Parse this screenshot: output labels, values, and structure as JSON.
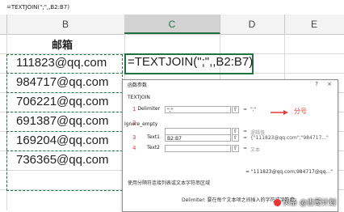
{
  "formula_bar": {
    "text": "=TEXTJOIN(\";\",,B2:B7)"
  },
  "columns": [
    "B",
    "C",
    "D",
    "E"
  ],
  "sheet": {
    "header": "邮箱",
    "emails": [
      "111823@qq.com",
      "984717@qq.com",
      "706221@qq.com",
      "691387@qq.com",
      "169204@qq.com",
      "736365@qq.com"
    ],
    "formula_cell": "=TEXTJOIN(\";\",,B2:B7)"
  },
  "dialog": {
    "title": "函数参数",
    "help": "?",
    "close": "×",
    "function_name": "TEXTJOIN",
    "args": [
      {
        "num": "1",
        "label": "Delimiter",
        "value": "\";\"",
        "eq": "=",
        "result": "\";\""
      },
      {
        "num": "2",
        "label": "Ignore_empty",
        "value": "",
        "eq": "=",
        "result": "逻辑值"
      },
      {
        "num": "3",
        "label": "Text1",
        "value": "B2:B7",
        "eq": "=",
        "result": "{\"111823@qq.com\";\"984717...\""
      },
      {
        "num": "4",
        "label": "Text2",
        "value": "",
        "eq": "=",
        "result": "文本"
      }
    ],
    "annotation": "分号",
    "result_line": "= \"111823@qq.com;984717@qq...\"",
    "description": "使用分隔符连接列表或文本字符串区域",
    "param_help_label": "Delimiter:",
    "param_help_text": "要在每个文本项之间插入的字符或字符串"
  },
  "watermark": "头条 @古哥计划",
  "colors": {
    "accent": "#217346",
    "annotation": "#e23c3c"
  }
}
